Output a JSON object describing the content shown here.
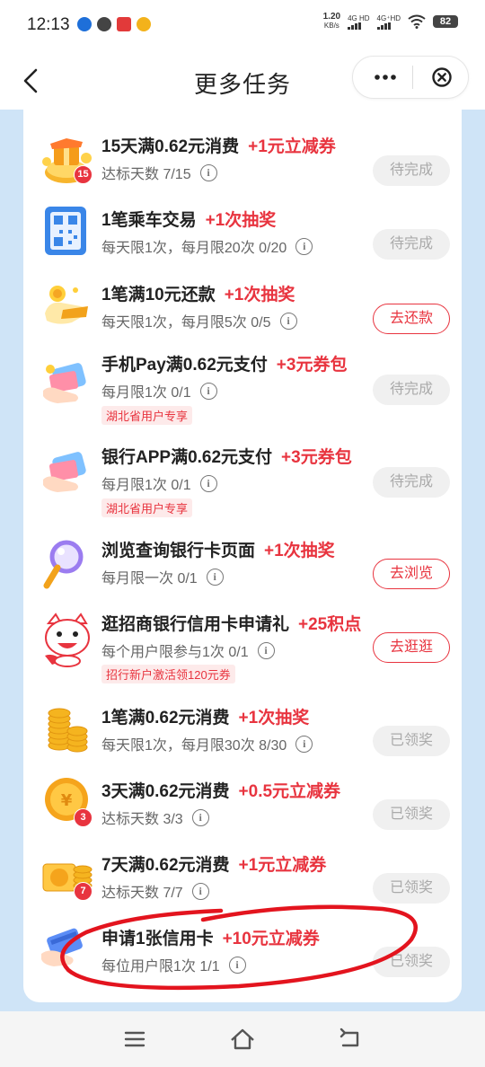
{
  "status_bar": {
    "time": "12:13",
    "net_speed": "1.20",
    "net_unit": "KB/s",
    "sig1": "4G HD",
    "sig2": "4G⁺HD",
    "battery": "82"
  },
  "header": {
    "title": "更多任务"
  },
  "tasks": [
    {
      "title": "15天满0.62元消费",
      "reward": "+1元立减券",
      "sub": "达标天数 7/15",
      "tag": "",
      "badge": "15",
      "button": "待完成"
    },
    {
      "title": "1笔乘车交易",
      "reward": "+1次抽奖",
      "sub": "每天限1次，每月限20次 0/20",
      "tag": "",
      "badge": "",
      "button": "待完成"
    },
    {
      "title": "1笔满10元还款",
      "reward": "+1次抽奖",
      "sub": "每天限1次，每月限5次 0/5",
      "tag": "",
      "badge": "",
      "button": "去还款"
    },
    {
      "title": "手机Pay满0.62元支付",
      "reward": "+3元券包",
      "sub": "每月限1次 0/1",
      "tag": "湖北省用户专享",
      "badge": "",
      "button": "待完成"
    },
    {
      "title": "银行APP满0.62元支付",
      "reward": "+3元券包",
      "sub": "每月限1次 0/1",
      "tag": "湖北省用户专享",
      "badge": "",
      "button": "待完成"
    },
    {
      "title": "浏览查询银行卡页面",
      "reward": "+1次抽奖",
      "sub": "每月限一次 0/1",
      "tag": "",
      "badge": "",
      "button": "去浏览"
    },
    {
      "title": "逛招商银行信用卡申请礼",
      "reward": "+25积点",
      "sub": "每个用户限参与1次 0/1",
      "tag": "招行新户激活领120元券",
      "badge": "",
      "button": "去逛逛"
    },
    {
      "title": "1笔满0.62元消费",
      "reward": "+1次抽奖",
      "sub": "每天限1次，每月限30次 8/30",
      "tag": "",
      "badge": "",
      "button": "已领奖"
    },
    {
      "title": "3天满0.62元消费",
      "reward": "+0.5元立减券",
      "sub": "达标天数 3/3",
      "tag": "",
      "badge": "3",
      "button": "已领奖"
    },
    {
      "title": "7天满0.62元消费",
      "reward": "+1元立减券",
      "sub": "达标天数 7/7",
      "tag": "",
      "badge": "7",
      "button": "已领奖"
    },
    {
      "title": "申请1张信用卡",
      "reward": "+10元立减券",
      "sub": "每位用户限1次 1/1",
      "tag": "",
      "badge": "",
      "button": "已领奖"
    }
  ],
  "colors": {
    "accent": "#e8343f",
    "background": "#cfe4f7",
    "disabled_button": "#f0f0f0"
  }
}
